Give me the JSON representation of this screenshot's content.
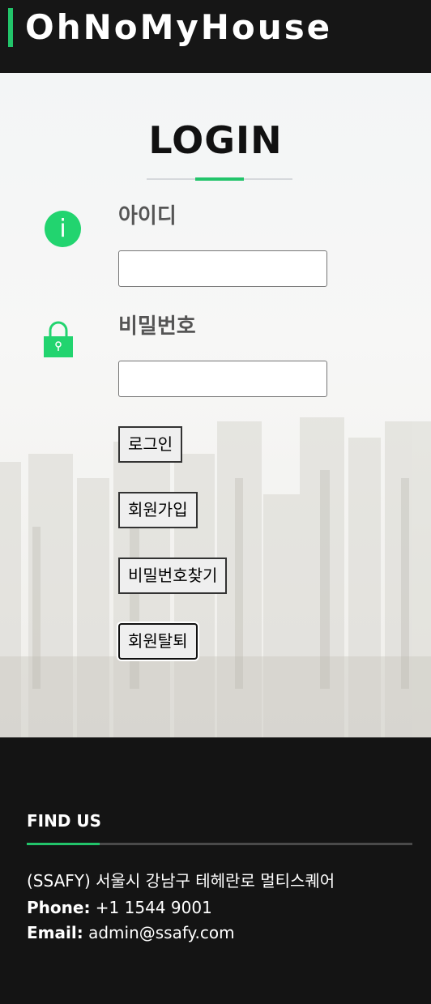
{
  "header": {
    "logo_text": "OhNoMyHouse"
  },
  "login": {
    "title": "LOGIN",
    "id_label": "아이디",
    "id_value": "",
    "password_label": "비밀번호",
    "password_value": "",
    "buttons": {
      "login": "로그인",
      "signup": "회원가입",
      "find_password": "비밀번호찾기",
      "withdraw": "회원탈퇴"
    },
    "info_icon_glyph": "i"
  },
  "footer": {
    "heading": "FIND US",
    "address": "(SSAFY) 서울시 강남구 테헤란로 멀티스퀘어",
    "phone_label": "Phone:",
    "phone": "+1 1544 9001",
    "email_label": "Email:",
    "email": "admin@ssafy.com"
  },
  "colors": {
    "accent": "#22c46a",
    "header_bg": "#161616",
    "footer_bg": "#141414"
  },
  "icons": [
    "info-icon",
    "lock-icon"
  ]
}
